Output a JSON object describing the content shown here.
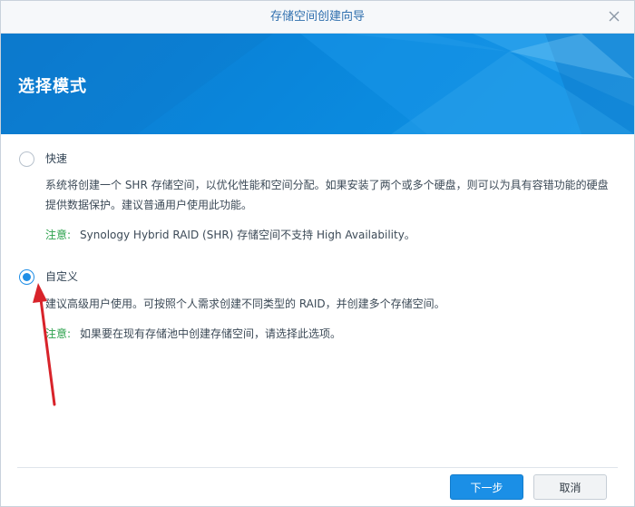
{
  "window": {
    "title": "存储空间创建向导"
  },
  "banner": {
    "title": "选择模式"
  },
  "options": [
    {
      "label": "快速",
      "selected": false,
      "description": "系统将创建一个 SHR 存储空间，以优化性能和空间分配。如果安装了两个或多个硬盘，则可以为具有容错功能的硬盘提供数据保护。建议普通用户使用此功能。",
      "note_label": "注意:",
      "note_text": "Synology Hybrid RAID (SHR) 存储空间不支持 High Availability。"
    },
    {
      "label": "自定义",
      "selected": true,
      "description": "建议高级用户使用。可按照个人需求创建不同类型的 RAID，并创建多个存储空间。",
      "note_label": "注意:",
      "note_text": "如果要在现有存储池中创建存储空间，请选择此选项。"
    }
  ],
  "buttons": {
    "next": "下一步",
    "cancel": "取消"
  },
  "colors": {
    "accent": "#1b8fe6",
    "note": "#29a04a",
    "annotation_arrow": "#d8232a"
  },
  "icons": {
    "close": "close-icon"
  }
}
